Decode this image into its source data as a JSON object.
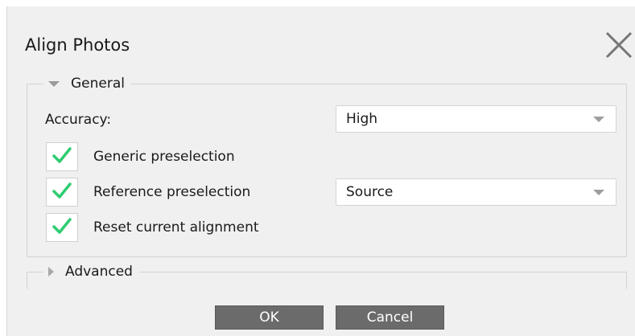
{
  "dialog": {
    "title": "Align Photos",
    "close_icon": "close-icon"
  },
  "general": {
    "header": "General",
    "expanded": true,
    "accuracy": {
      "label": "Accuracy:",
      "value": "High"
    },
    "generic_preselection": {
      "label": "Generic preselection",
      "checked": true
    },
    "reference_preselection": {
      "label": "Reference preselection",
      "checked": true,
      "value": "Source"
    },
    "reset_alignment": {
      "label": "Reset current alignment",
      "checked": true
    }
  },
  "advanced": {
    "header": "Advanced",
    "expanded": false
  },
  "buttons": {
    "ok": "OK",
    "cancel": "Cancel"
  },
  "colors": {
    "dialog_bg": "#f0f0f0",
    "check": "#2ecc71",
    "button_bg": "#6b6b6b"
  }
}
